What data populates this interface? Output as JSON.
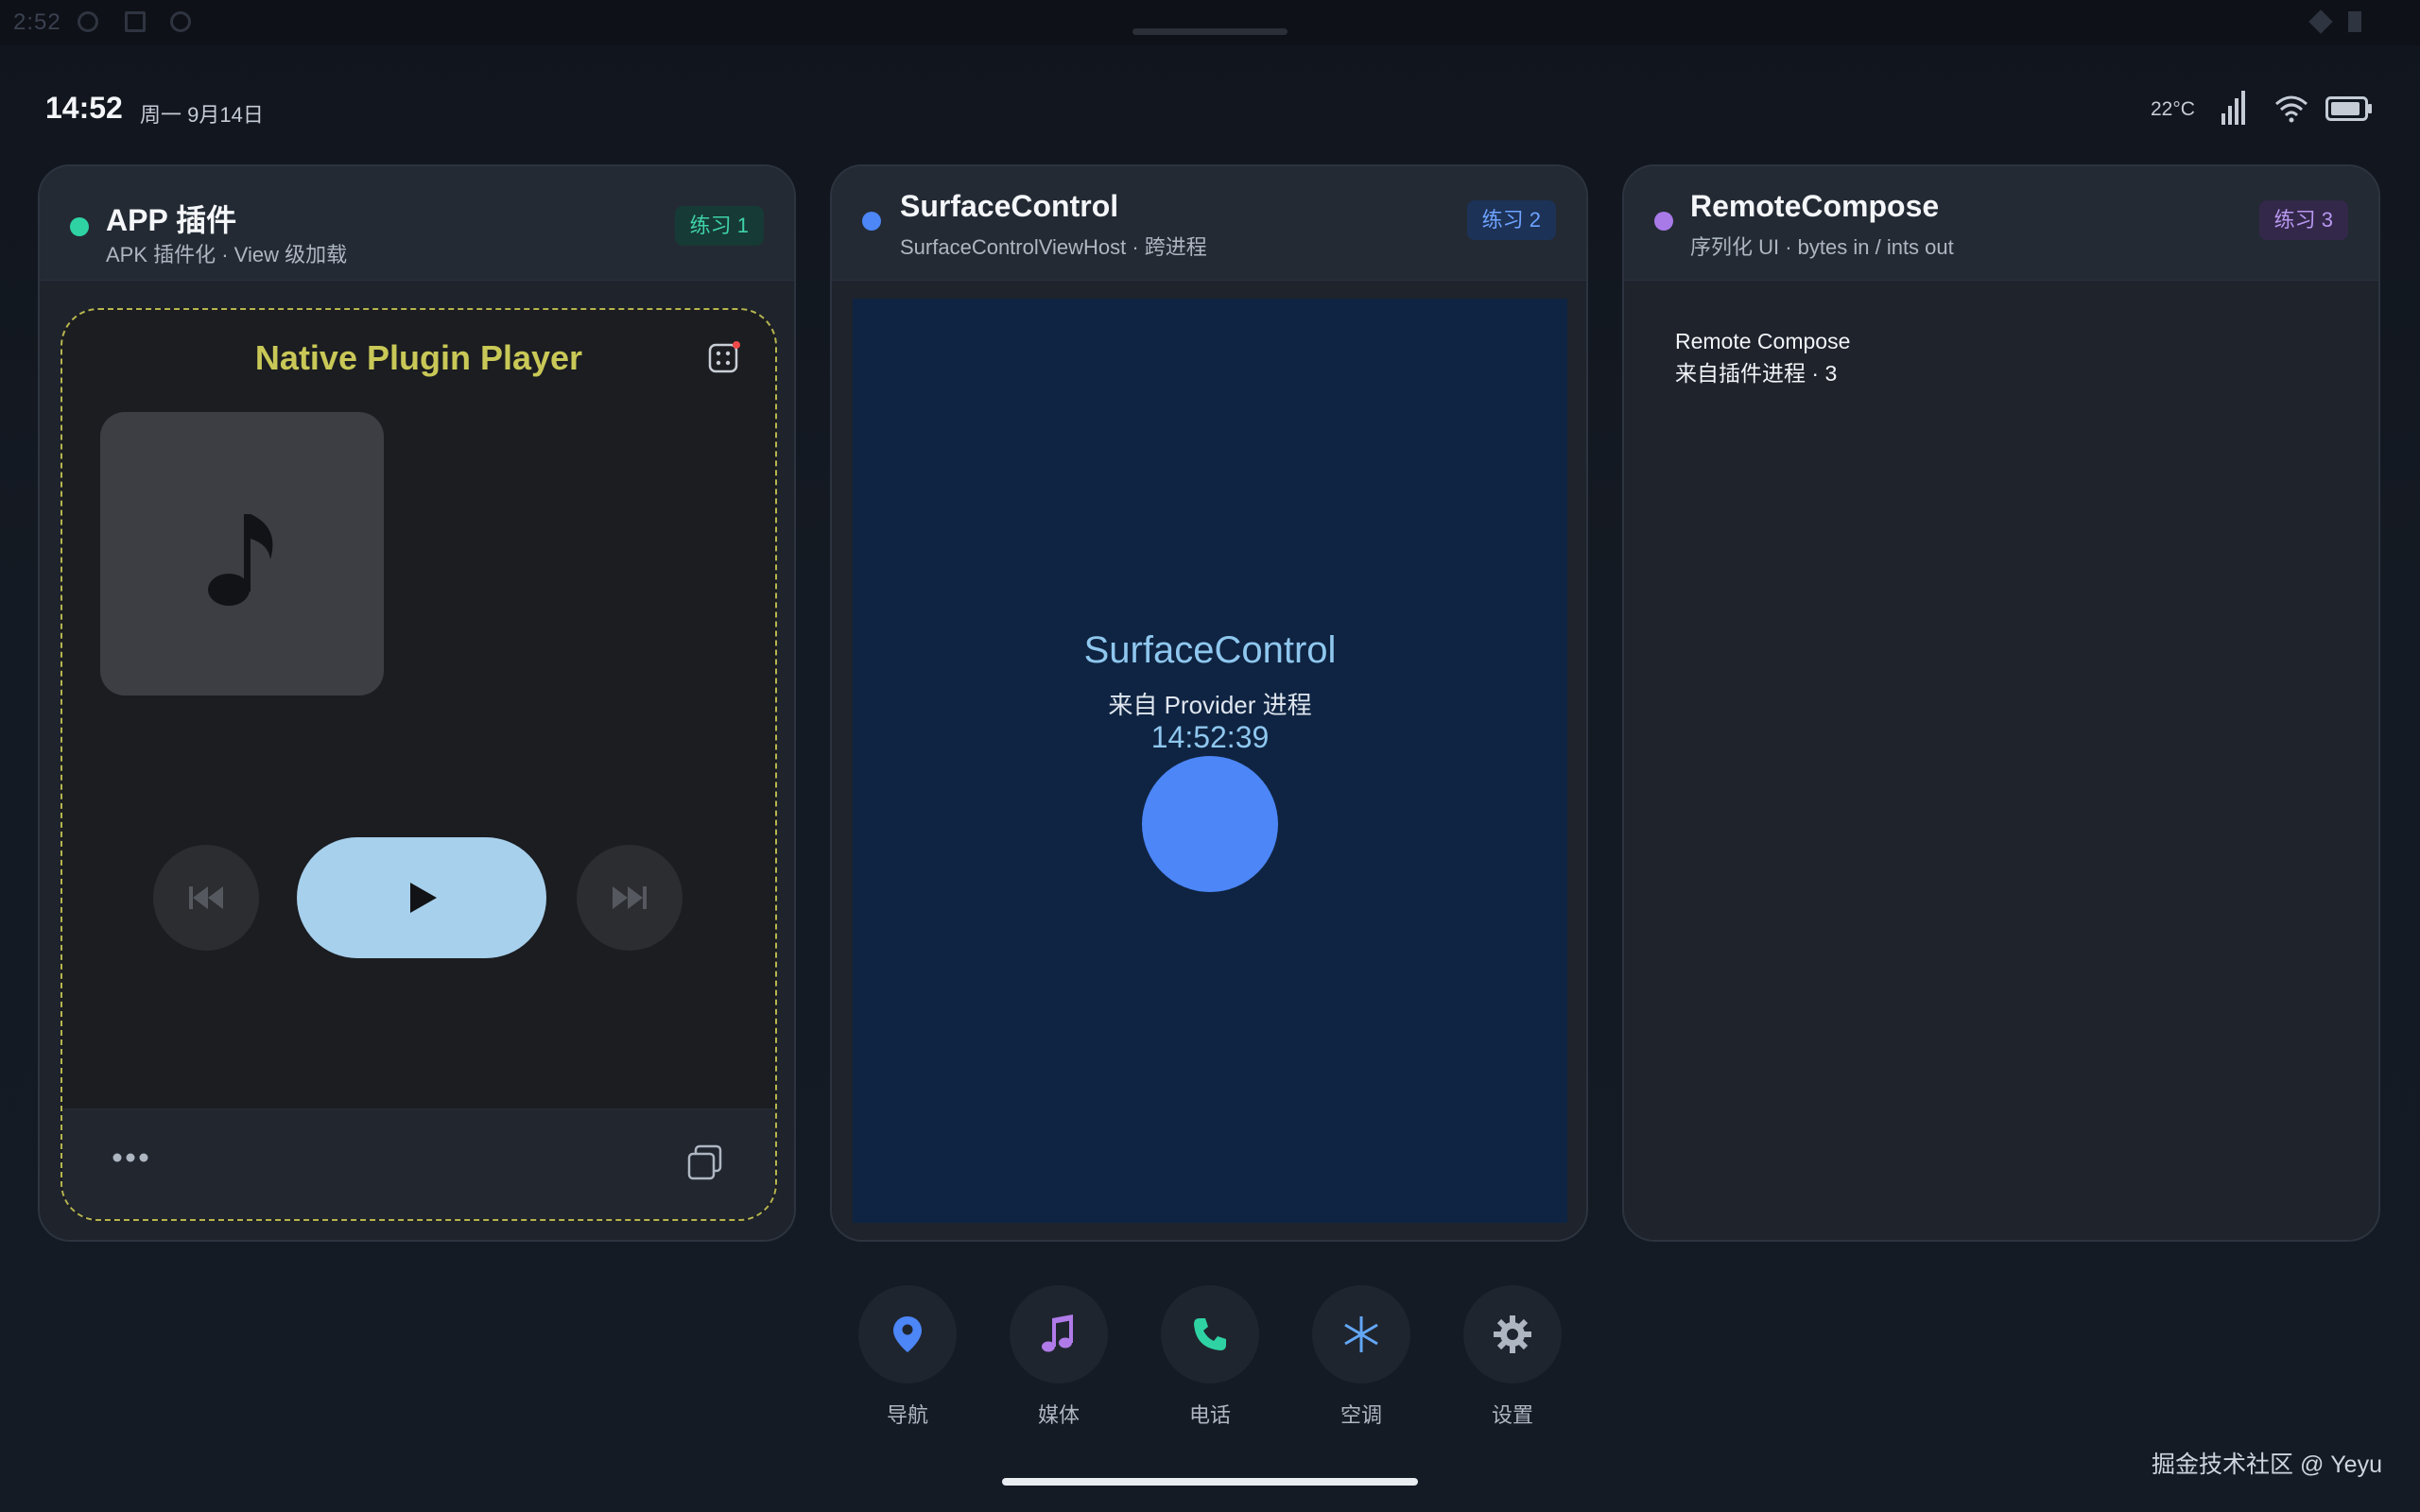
{
  "system": {
    "time": "2:52"
  },
  "status": {
    "clock": "14:52",
    "date": "周一 9月14日",
    "temperature": "22°C"
  },
  "cards": [
    {
      "title": "APP 插件",
      "subtitle": "APK 插件化 · View 级加载",
      "badge": "练习 1",
      "dot_color": "#2fd3a3",
      "badge_bg": "#163a35",
      "badge_fg": "#3fd3a8",
      "player": {
        "title": "Native Plugin Player"
      }
    },
    {
      "title": "SurfaceControl",
      "subtitle": "SurfaceControlViewHost · 跨进程",
      "badge": "练习 2",
      "dot_color": "#4c86f7",
      "badge_bg": "#1d3257",
      "badge_fg": "#6ea3ff",
      "content": {
        "title": "SurfaceControl",
        "subtitle": "来自 Provider 进程",
        "time": "14:52:39"
      }
    },
    {
      "title": "RemoteCompose",
      "subtitle": "序列化 UI · bytes in / ints out",
      "badge": "练习 3",
      "dot_color": "#a77ae8",
      "badge_bg": "#33284a",
      "badge_fg": "#b897f0",
      "content": {
        "line1": "Remote Compose",
        "line2": "来自插件进程 · 3"
      }
    }
  ],
  "dock": [
    {
      "label": "导航",
      "icon": "location-pin-icon",
      "color": "#4c86f7"
    },
    {
      "label": "媒体",
      "icon": "music-note-icon",
      "color": "#b07be8"
    },
    {
      "label": "电话",
      "icon": "phone-icon",
      "color": "#2fd3a3"
    },
    {
      "label": "空调",
      "icon": "snowflake-icon",
      "color": "#63a7f7"
    },
    {
      "label": "设置",
      "icon": "gear-icon",
      "color": "#aeb6c2"
    }
  ],
  "watermark": "掘金技术社区 @ Yeyu"
}
